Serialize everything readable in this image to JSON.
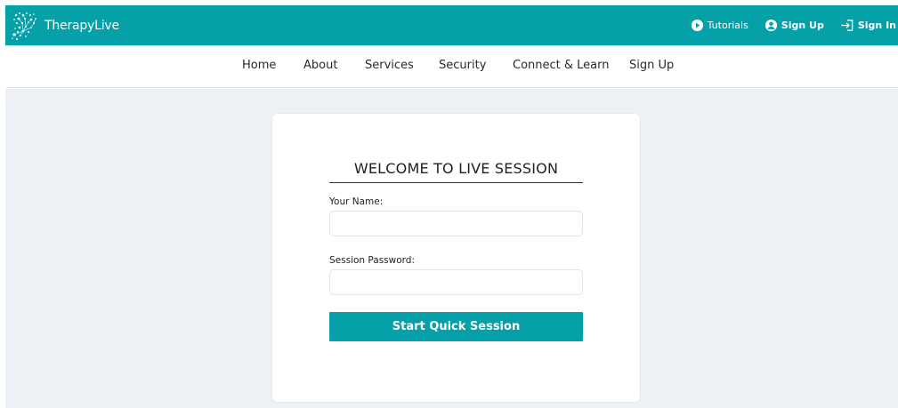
{
  "brand": {
    "name": "TherapyLive"
  },
  "top_actions": {
    "tutorials": "Tutorials",
    "sign_up": "Sign Up",
    "sign_in": "Sign In"
  },
  "nav": {
    "items": [
      "Home",
      "About",
      "Services",
      "Security",
      "Connect & Learn",
      "Sign Up"
    ]
  },
  "form": {
    "title": "WELCOME TO LIVE SESSION",
    "name_label": "Your Name:",
    "name_value": "",
    "password_label": "Session Password:",
    "password_value": "",
    "submit_label": "Start Quick Session"
  },
  "colors": {
    "accent": "#06a0a8",
    "background": "#edf0f4",
    "card": "#ffffff"
  },
  "icons": {
    "logo": "tree-dots-logo",
    "tutorials": "play-circle-icon",
    "sign_up": "user-circle-icon",
    "sign_in": "sign-in-arrow-icon"
  }
}
